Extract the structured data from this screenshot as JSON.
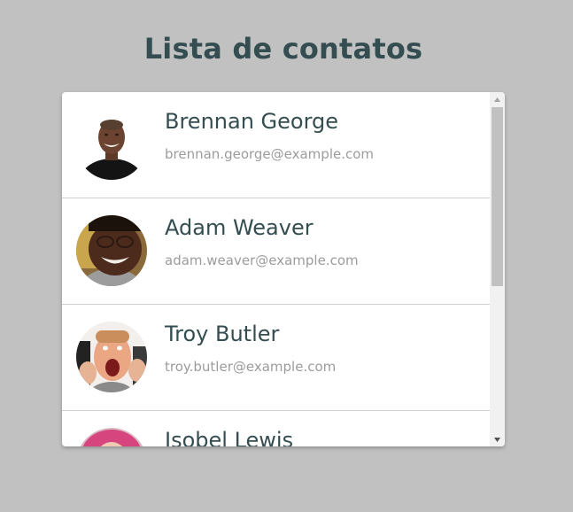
{
  "page": {
    "title": "Lista de contatos"
  },
  "contacts": [
    {
      "name": "Brennan George",
      "email": "brennan.george@example.com",
      "avatar_icon": "person-photo-icon"
    },
    {
      "name": "Adam Weaver",
      "email": "adam.weaver@example.com",
      "avatar_icon": "person-photo-icon"
    },
    {
      "name": "Troy Butler",
      "email": "troy.butler@example.com",
      "avatar_icon": "person-photo-icon"
    },
    {
      "name": "Isobel Lewis",
      "email": "",
      "avatar_icon": "person-photo-icon"
    }
  ],
  "colors": {
    "background": "#c1c1c1",
    "heading": "#344d50",
    "name": "#344d50",
    "email": "#9c9c9c",
    "divider": "#cfcfcf"
  },
  "scrollbar": {
    "up_icon": "triangle-up-icon",
    "down_icon": "triangle-down-icon"
  }
}
